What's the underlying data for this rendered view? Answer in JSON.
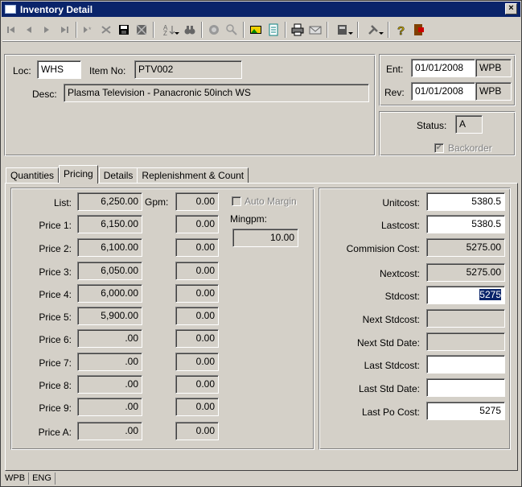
{
  "window": {
    "title": "Inventory Detail",
    "close_label": "×"
  },
  "toolbar": {
    "buttons": [
      "first-icon",
      "prev-icon",
      "next-icon",
      "last-icon",
      "new-record-icon",
      "delete-icon",
      "save-icon",
      "cancel-icon",
      "sort-icon",
      "find-icon",
      "binoculars-icon",
      "zoom-icon",
      "image-icon",
      "notes-icon",
      "print-icon",
      "email-icon",
      "report-icon",
      "tools-icon",
      "help-icon",
      "exit-icon"
    ]
  },
  "header": {
    "loc_label": "Loc:",
    "loc_value": "WHS",
    "item_no_label": "Item No:",
    "item_no_value": "PTV002",
    "desc_label": "Desc:",
    "desc_value": "Plasma Television - Panacronic 50inch WS",
    "ent_label": "Ent:",
    "ent_date": "01/01/2008",
    "ent_user": "WPB",
    "rev_label": "Rev:",
    "rev_date": "01/01/2008",
    "rev_user": "WPB",
    "status_label": "Status:",
    "status_value": "A",
    "backorder_label": "Backorder",
    "backorder_mark": "✔"
  },
  "tabs": [
    "Quantities",
    "Pricing",
    "Details",
    "Replenishment & Count"
  ],
  "active_tab": "Pricing",
  "pricing": {
    "gpm_label": "Gpm:",
    "auto_margin_label": "Auto Margin",
    "mingpm_label": "Mingpm:",
    "mingpm_value": "10.00",
    "rows": [
      {
        "label": "List:",
        "price": "6,250.00",
        "gpm": "0.00"
      },
      {
        "label": "Price 1:",
        "price": "6,150.00",
        "gpm": "0.00"
      },
      {
        "label": "Price 2:",
        "price": "6,100.00",
        "gpm": "0.00"
      },
      {
        "label": "Price 3:",
        "price": "6,050.00",
        "gpm": "0.00"
      },
      {
        "label": "Price 4:",
        "price": "6,000.00",
        "gpm": "0.00"
      },
      {
        "label": "Price 5:",
        "price": "5,900.00",
        "gpm": "0.00"
      },
      {
        "label": "Price 6:",
        "price": ".00",
        "gpm": "0.00"
      },
      {
        "label": "Price 7:",
        "price": ".00",
        "gpm": "0.00"
      },
      {
        "label": "Price 8:",
        "price": ".00",
        "gpm": "0.00"
      },
      {
        "label": "Price 9:",
        "price": ".00",
        "gpm": "0.00"
      },
      {
        "label": "Price A:",
        "price": ".00",
        "gpm": "0.00"
      }
    ]
  },
  "costs": [
    {
      "label": "Unitcost:",
      "value": "5380.5",
      "editable": true
    },
    {
      "label": "Lastcost:",
      "value": "5380.5",
      "editable": true
    },
    {
      "label": "Commision Cost:",
      "value": "5275.00",
      "editable": false
    },
    {
      "label": "Nextcost:",
      "value": "5275.00",
      "editable": false
    },
    {
      "label": "Stdcost:",
      "value": "5275",
      "editable": true,
      "selected": true
    },
    {
      "label": "Next Stdcost:",
      "value": "",
      "editable": false
    },
    {
      "label": "Next Std Date:",
      "value": "",
      "editable": false
    },
    {
      "label": "Last Stdcost:",
      "value": "",
      "editable": true
    },
    {
      "label": "Last Std Date:",
      "value": "",
      "editable": true
    },
    {
      "label": "Last Po Cost:",
      "value": "5275",
      "editable": true
    }
  ],
  "statusbar": {
    "user": "WPB",
    "lang": "ENG"
  }
}
